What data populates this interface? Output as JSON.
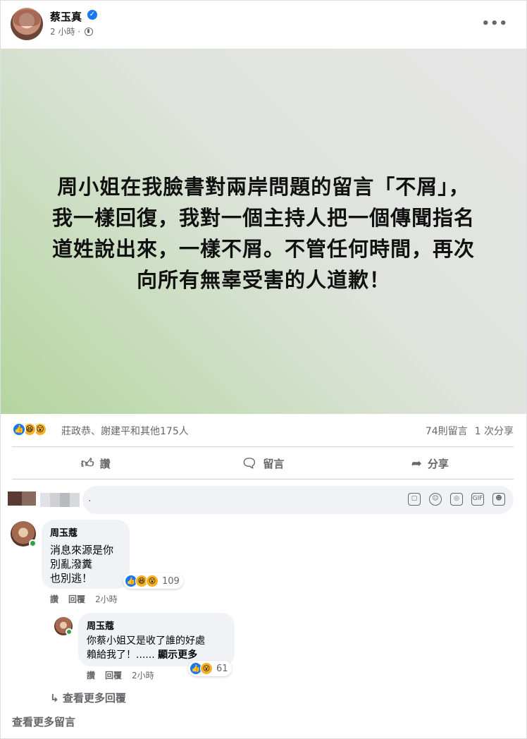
{
  "post": {
    "author": "蔡玉真",
    "time": "2 小時 ·",
    "image_text": "周小姐在我臉書對兩岸問題的留言「不屑」，\n我一樣回復，我對一個主持人把一個傳聞指名\n道姓說出來，一樣不屑。不管任何時間，再次\n向所有無辜受害的人道歉！",
    "reactors": "莊政恭、謝建平和其他175人",
    "comment_count": "74則留言",
    "share_count": "1 次分享"
  },
  "actions": {
    "like": "讚",
    "comment": "留言",
    "share": "分享"
  },
  "composer": {
    "placeholder": "."
  },
  "comments": [
    {
      "author": "周玉蔻",
      "text": "消息來源是你\n別亂潑糞\n也別逃！",
      "reaction_count": "109",
      "like_label": "讚",
      "reply_label": "回覆",
      "time": "2小時"
    }
  ],
  "reply": {
    "author": "周玉蔻",
    "text": "你蔡小姐又是收了誰的好處\n賴給我了！......",
    "see_more": "顯示更多",
    "reaction_count": "61",
    "like_label": "讚",
    "reply_label": "回覆",
    "time": "2小時"
  },
  "links": {
    "more_replies": "查看更多回覆",
    "more_comments": "查看更多留言"
  },
  "colors": {
    "like_blue": "#1877f2",
    "emoji_yellow": "#f7b125",
    "muted_text": "#65676b",
    "online_green": "#31a24c"
  },
  "icons": [
    "verified-icon",
    "globe-icon",
    "more-icon",
    "like-icon",
    "comment-icon",
    "share-icon",
    "sticker-icon",
    "emoji-icon",
    "camera-icon",
    "gif-icon",
    "avatar-icon",
    "reply-arrow-icon"
  ]
}
